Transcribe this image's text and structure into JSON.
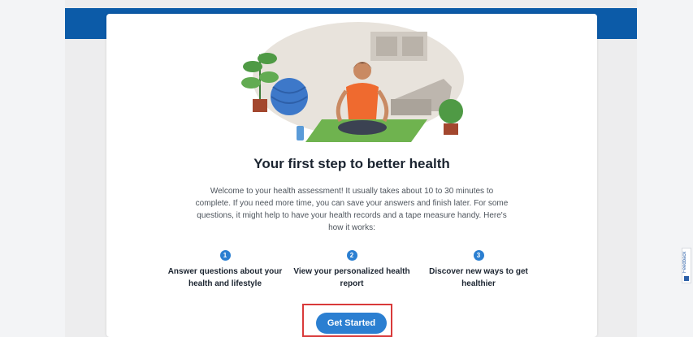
{
  "main": {
    "title": "Your first step to better health",
    "intro": "Welcome to your health assessment! It usually takes about 10 to 30 minutes to complete. If you need more time, you can save your answers and finish later. For some questions, it might help to have your health records and a tape measure handy. Here's how it works:",
    "steps": [
      {
        "number": "1",
        "text": "Answer questions about your health and lifestyle"
      },
      {
        "number": "2",
        "text": "View your personalized health report"
      },
      {
        "number": "3",
        "text": "Discover new ways to get healthier"
      }
    ],
    "cta_label": "Get Started"
  },
  "feedback": {
    "label": "Feedback"
  },
  "colors": {
    "header_blue": "#0c5ba8",
    "accent_blue": "#2b7fd1",
    "highlight_red": "#d93a3a"
  },
  "illustration": {
    "subject": "woman meditating on yoga mat with plants and exercise ball"
  }
}
